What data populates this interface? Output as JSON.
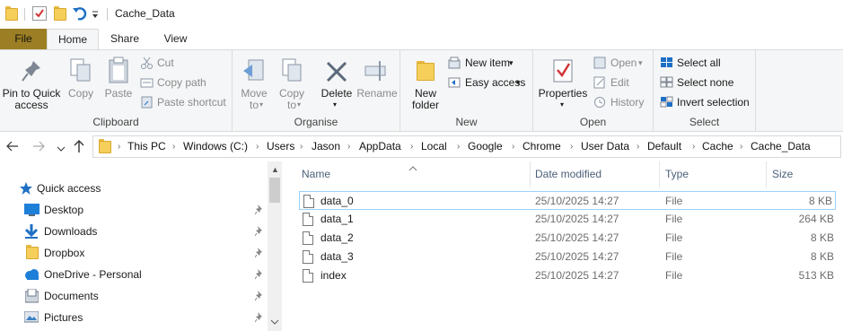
{
  "window": {
    "title": "Cache_Data"
  },
  "ribbon_tabs": [
    "File",
    "Home",
    "Share",
    "View"
  ],
  "ribbon": {
    "clipboard": {
      "label": "Clipboard",
      "pin_to_quick_access": "Pin to Quick access",
      "copy": "Copy",
      "paste": "Paste",
      "cut": "Cut",
      "copy_path": "Copy path",
      "paste_shortcut": "Paste shortcut"
    },
    "organise": {
      "label": "Organise",
      "move_to": "Move to",
      "copy_to": "Copy to",
      "delete": "Delete",
      "rename": "Rename"
    },
    "new": {
      "label": "New",
      "new_folder": "New folder",
      "new_item": "New item",
      "easy_access": "Easy access"
    },
    "open": {
      "label": "Open",
      "properties": "Properties",
      "open": "Open",
      "edit": "Edit",
      "history": "History"
    },
    "select": {
      "label": "Select",
      "select_all": "Select all",
      "select_none": "Select none",
      "invert_selection": "Invert selection"
    }
  },
  "breadcrumb": [
    "This PC",
    "Windows (C:)",
    "Users",
    "Jason",
    "AppData",
    "Local",
    "Google",
    "Chrome",
    "User Data",
    "Default",
    "Cache",
    "Cache_Data"
  ],
  "nav_pane": {
    "items": [
      {
        "label": "Quick access",
        "icon": "star-icon",
        "pinned": false
      },
      {
        "label": "Desktop",
        "icon": "desktop-icon",
        "pinned": true
      },
      {
        "label": "Downloads",
        "icon": "download-arrow-icon",
        "pinned": true
      },
      {
        "label": "Dropbox",
        "icon": "folder-icon",
        "pinned": true
      },
      {
        "label": "OneDrive - Personal",
        "icon": "cloud-icon",
        "pinned": true
      },
      {
        "label": "Documents",
        "icon": "document-icon",
        "pinned": true
      },
      {
        "label": "Pictures",
        "icon": "pictures-icon",
        "pinned": true
      }
    ]
  },
  "file_list": {
    "columns": [
      "Name",
      "Date modified",
      "Type",
      "Size"
    ],
    "rows": [
      {
        "name": "data_0",
        "date": "25/10/2025 14:27",
        "type": "File",
        "size": "8 KB",
        "selected": true
      },
      {
        "name": "data_1",
        "date": "25/10/2025 14:27",
        "type": "File",
        "size": "264 KB"
      },
      {
        "name": "data_2",
        "date": "25/10/2025 14:27",
        "type": "File",
        "size": "8 KB"
      },
      {
        "name": "data_3",
        "date": "25/10/2025 14:27",
        "type": "File",
        "size": "8 KB"
      },
      {
        "name": "index",
        "date": "25/10/2025 14:27",
        "type": "File",
        "size": "513 KB"
      }
    ]
  },
  "colors": {
    "file_tab": "#9c7f24",
    "folder": "#f5cf5a",
    "accent_blue": "#1e6fc5",
    "selection_border": "#99d1ff"
  }
}
